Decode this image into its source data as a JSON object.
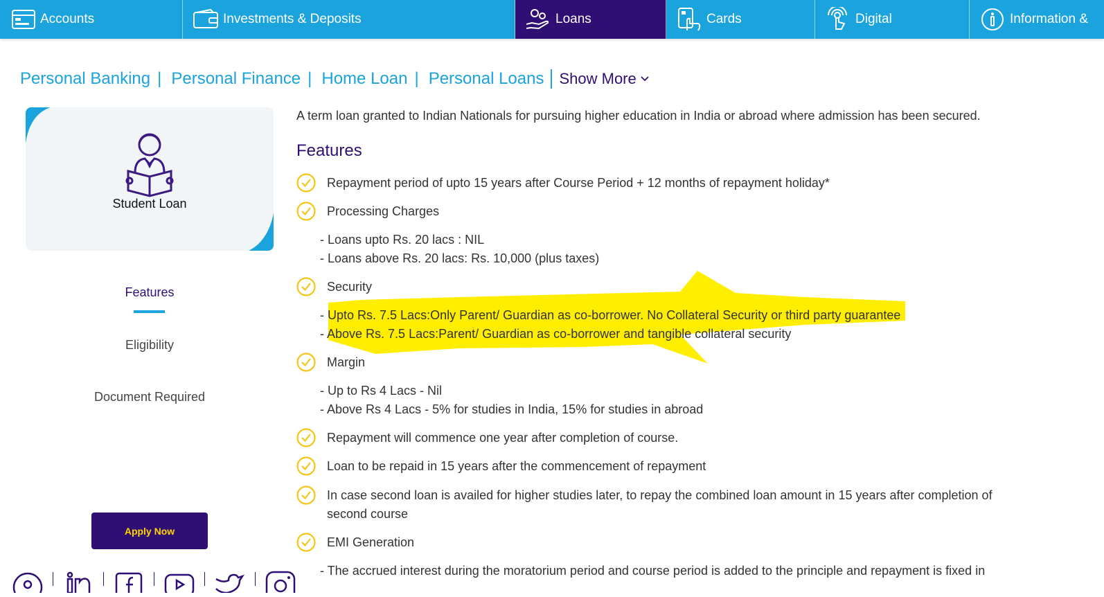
{
  "nav": {
    "items": [
      {
        "label": "Accounts",
        "icon": "accounts-icon"
      },
      {
        "label": "Investments & Deposits",
        "icon": "wallet-icon"
      },
      {
        "label": "Loans",
        "icon": "loan-hand-icon",
        "active": true
      },
      {
        "label": "Cards",
        "icon": "cards-icon"
      },
      {
        "label": "Digital",
        "icon": "digital-touch-icon"
      },
      {
        "label": "Information &",
        "icon": "info-icon"
      }
    ]
  },
  "breadcrumb": {
    "items": [
      "Personal Banking",
      "Personal Finance",
      "Home Loan",
      "Personal Loans"
    ],
    "separator": "|",
    "show_more": "Show More"
  },
  "product": {
    "title": "Student Loan",
    "icon": "student-reading-icon"
  },
  "side_tabs": [
    "Features",
    "Eligibility",
    "Document Required"
  ],
  "apply_label": "Apply Now",
  "social_icons": [
    "pinterest-icon",
    "linkedin-icon",
    "facebook-icon",
    "youtube-icon",
    "twitter-icon",
    "instagram-icon"
  ],
  "content": {
    "intro": "A term loan granted to Indian Nationals for pursuing higher education in India or abroad where admission has been secured.",
    "heading": "Features",
    "features": [
      "Repayment period of upto 15 years after Course Period + 12 months of repayment holiday*",
      "Processing Charges",
      "Security",
      "Margin",
      "Repayment will commence one year after completion of course.",
      "Loan to be repaid in 15 years after the commencement of repayment",
      "In case second loan is availed for higher studies later, to repay the combined loan amount in 15 years after completion of",
      "second course",
      "EMI Generation"
    ],
    "processing": [
      "- Loans upto Rs. 20 lacs : NIL",
      "- Loans above Rs. 20 lacs: Rs. 10,000 (plus taxes)"
    ],
    "security": [
      "- Upto Rs. 7.5 Lacs:Only Parent/ Guardian as co-borrower. No Collateral Security or third party guarantee",
      "- Above Rs. 7.5 Lacs:Parent/ Guardian as co-borrower and tangible collateral security"
    ],
    "margin": [
      "- Up to Rs 4 Lacs - Nil",
      "- Above Rs 4 Lacs - 5% for studies in India, 15% for studies in abroad"
    ],
    "emi": [
      "- The accrued interest during the moratorium period and course period is added to the principle and repayment is fixed in"
    ]
  },
  "colors": {
    "nav_bg": "#1aa3dc",
    "nav_active": "#2f0f74",
    "brand_purple": "#2f0f74",
    "check_yellow": "#f5c518",
    "highlight_yellow": "#ffee00",
    "apply_text": "#ffd400"
  }
}
